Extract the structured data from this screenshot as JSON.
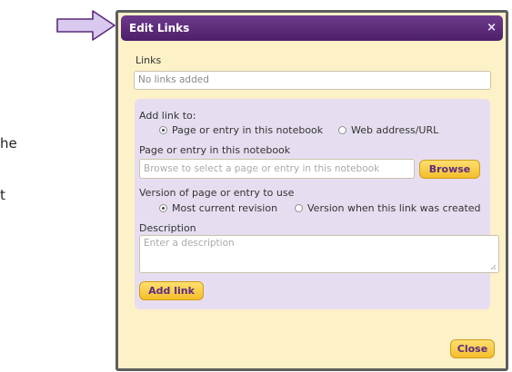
{
  "background": {
    "text_he": "he",
    "text_t": "t"
  },
  "dialog": {
    "title": "Edit Links",
    "close_glyph": "×",
    "links_label": "Links",
    "links_value": "No links added",
    "add_link_to_label": "Add link to:",
    "link_type_options": [
      {
        "label": "Page or entry in this notebook",
        "selected": true
      },
      {
        "label": "Web address/URL",
        "selected": false
      }
    ],
    "page_entry_label": "Page or entry in this notebook",
    "page_entry_placeholder": "Browse to select a page or entry in this notebook",
    "browse_button": "Browse",
    "version_label": "Version of page or entry to use",
    "version_options": [
      {
        "label": "Most current revision",
        "selected": true
      },
      {
        "label": "Version when this link was created",
        "selected": false
      }
    ],
    "description_label": "Description",
    "description_placeholder": "Enter a description",
    "add_link_button": "Add link",
    "close_button": "Close"
  },
  "colors": {
    "titlebar": "#5a2a78",
    "dialog_bg": "#fdf1c8",
    "panel_bg": "#e6def0",
    "button_bg": "#f8c93a",
    "button_text": "#5b2c80",
    "arrow_fill": "#d9c9ee",
    "arrow_stroke": "#5a2a78"
  },
  "icons": {
    "pointer": "arrow-right-icon",
    "close": "close-icon",
    "resize": "resize-grip-icon"
  }
}
